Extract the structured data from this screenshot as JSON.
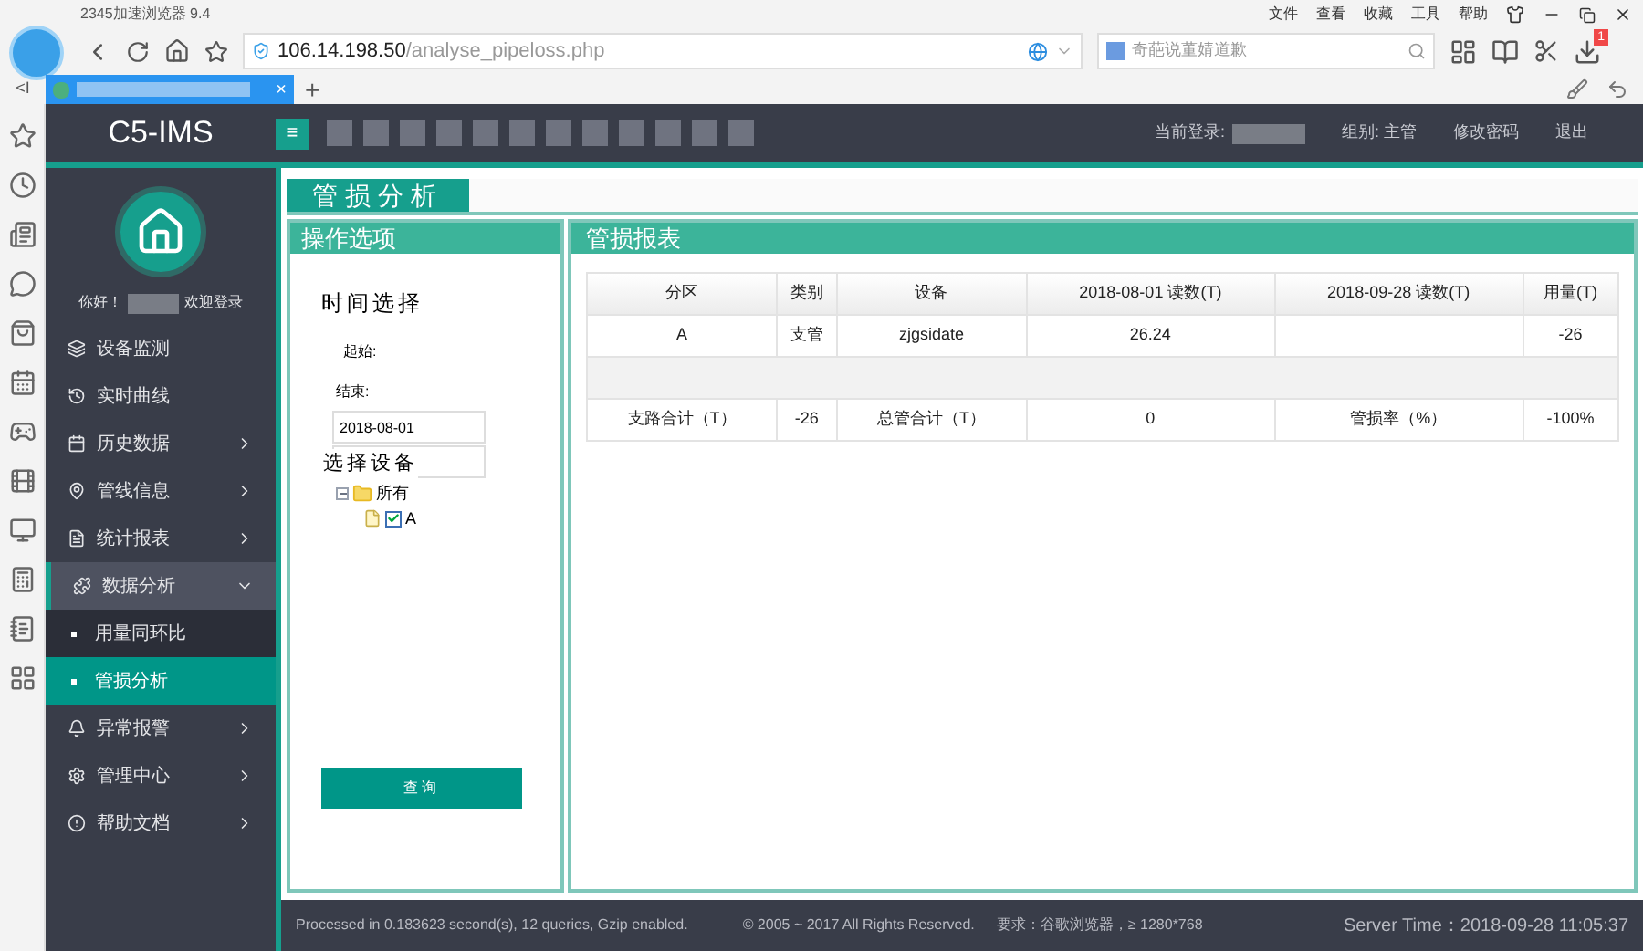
{
  "browser": {
    "title": "2345加速浏览器 9.4",
    "url_host": "106.14.198.50",
    "url_path": "/analyse_pipeloss.php",
    "search_placeholder": "奇葩说董婧道歉",
    "menu": [
      "文件",
      "查看",
      "收藏",
      "工具",
      "帮助"
    ],
    "download_badge": "1",
    "tab_close": "×",
    "new_tab": "+",
    "sidebar_toggle": "<I"
  },
  "header": {
    "logo": "C5-IMS",
    "menu_button": "≡",
    "login_label": "当前登录:",
    "group": "组别: 主管",
    "change_password": "修改密码",
    "logout": "退出"
  },
  "sidebar": {
    "greeting": "你好！",
    "welcome": "欢迎登录",
    "items": [
      {
        "label": "设备监测",
        "expanded": false,
        "has_children": false
      },
      {
        "label": "实时曲线",
        "expanded": false,
        "has_children": false
      },
      {
        "label": "历史数据",
        "expanded": false,
        "has_children": true
      },
      {
        "label": "管线信息",
        "expanded": false,
        "has_children": true
      },
      {
        "label": "统计报表",
        "expanded": false,
        "has_children": true
      },
      {
        "label": "数据分析",
        "expanded": true,
        "has_children": true,
        "children": [
          {
            "label": "用量同环比",
            "selected": false
          },
          {
            "label": "管损分析",
            "selected": true
          }
        ]
      },
      {
        "label": "异常报警",
        "expanded": false,
        "has_children": true
      },
      {
        "label": "管理中心",
        "expanded": false,
        "has_children": true
      },
      {
        "label": "帮助文档",
        "expanded": false,
        "has_children": true
      }
    ]
  },
  "page_title": "管损分析",
  "options_panel": {
    "title": "操作选项",
    "time_heading": "时间选择",
    "start_label": "起始:",
    "end_label": "结束:",
    "start_value": "2018-08-01",
    "device_heading": "选择设备",
    "tree": [
      {
        "label": "所有",
        "expanded": true,
        "children": [
          {
            "label": "A",
            "checked": true
          }
        ]
      }
    ],
    "query_button": "查询"
  },
  "report_panel": {
    "title": "管损报表",
    "table": {
      "columns": [
        "分区",
        "类别",
        "设备",
        "2018-08-01 读数(T)",
        "2018-09-28 读数(T)",
        "用量(T)"
      ],
      "rows": [
        [
          "A",
          "支管",
          "zjgsidate",
          "26.24",
          "",
          "-26"
        ]
      ],
      "summary": [
        "支路合计（T）",
        "-26",
        "总管合计（T）",
        "0",
        "管损率（%）",
        "-100%"
      ]
    }
  },
  "footer": {
    "processed": "Processed in 0.183623 second(s), 12 queries, Gzip enabled.",
    "copyright": "© 2005 ~ 2017 All Rights Reserved.",
    "requirement": "要求：谷歌浏览器，≥ 1280*768",
    "server_time": "Server Time：2018-09-28 11:05:37"
  }
}
